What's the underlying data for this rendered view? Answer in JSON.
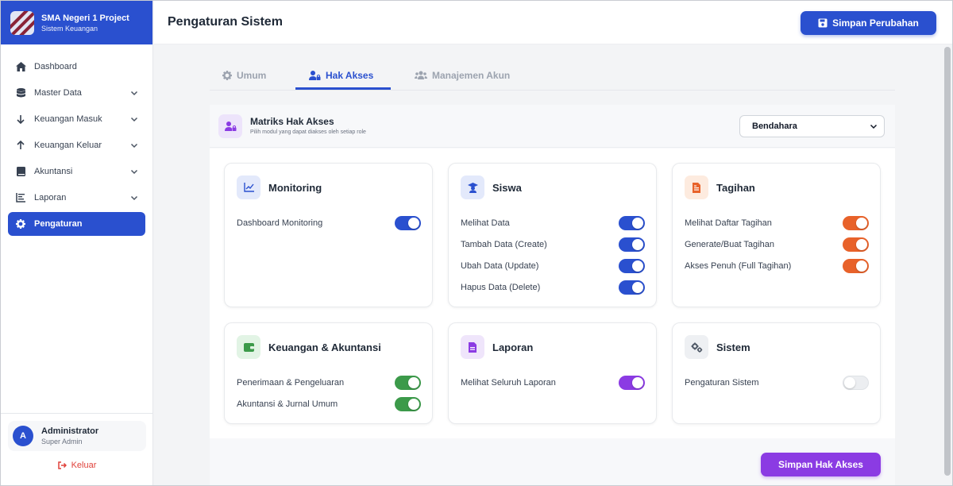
{
  "brand": {
    "name": "SMA Negeri 1 Project",
    "subtitle": "Sistem Keuangan"
  },
  "sidebar": {
    "items": [
      {
        "label": "Dashboard",
        "icon": "home-icon",
        "has_chevron": false,
        "active": false
      },
      {
        "label": "Master Data",
        "icon": "database-icon",
        "has_chevron": true,
        "active": false
      },
      {
        "label": "Keuangan Masuk",
        "icon": "arrow-down-icon",
        "has_chevron": true,
        "active": false
      },
      {
        "label": "Keuangan Keluar",
        "icon": "arrow-up-icon",
        "has_chevron": true,
        "active": false
      },
      {
        "label": "Akuntansi",
        "icon": "book-icon",
        "has_chevron": true,
        "active": false
      },
      {
        "label": "Laporan",
        "icon": "chart-bars-icon",
        "has_chevron": true,
        "active": false
      },
      {
        "label": "Pengaturan",
        "icon": "gear-icon",
        "has_chevron": false,
        "active": true
      }
    ],
    "user": {
      "avatar_letter": "A",
      "name": "Administrator",
      "role": "Super Admin"
    },
    "logout_label": "Keluar"
  },
  "header": {
    "title": "Pengaturan Sistem",
    "save_label": "Simpan Perubahan"
  },
  "tabs": [
    {
      "label": "Umum",
      "icon": "gear-icon",
      "active": false
    },
    {
      "label": "Hak Akses",
      "icon": "user-lock-icon",
      "active": true
    },
    {
      "label": "Manajemen Akun",
      "icon": "users-icon",
      "active": false
    }
  ],
  "panel": {
    "title": "Matriks Hak Akses",
    "subtitle": "Pilih modul yang dapat diakses oleh setiap role",
    "role_selected": "Bendahara",
    "save_access_label": "Simpan Hak Akses"
  },
  "modules": [
    {
      "title": "Monitoring",
      "icon": "chart-line-icon",
      "accent": "#2a50cf",
      "icon_bg": "#e3e9fb",
      "permissions": [
        {
          "label": "Dashboard Monitoring",
          "enabled": true
        }
      ]
    },
    {
      "title": "Siswa",
      "icon": "graduate-icon",
      "accent": "#2a50cf",
      "icon_bg": "#e3e9fb",
      "permissions": [
        {
          "label": "Melihat Data",
          "enabled": true
        },
        {
          "label": "Tambah Data (Create)",
          "enabled": true
        },
        {
          "label": "Ubah Data (Update)",
          "enabled": true
        },
        {
          "label": "Hapus Data (Delete)",
          "enabled": true
        }
      ]
    },
    {
      "title": "Tagihan",
      "icon": "invoice-icon",
      "accent": "#e8622a",
      "icon_bg": "#fdebdf",
      "permissions": [
        {
          "label": "Melihat Daftar Tagihan",
          "enabled": true
        },
        {
          "label": "Generate/Buat Tagihan",
          "enabled": true
        },
        {
          "label": "Akses Penuh (Full Tagihan)",
          "enabled": true
        }
      ]
    },
    {
      "title": "Keuangan & Akuntansi",
      "icon": "wallet-icon",
      "accent": "#3c9a4a",
      "icon_bg": "#e2f4e5",
      "permissions": [
        {
          "label": "Penerimaan & Pengeluaran",
          "enabled": true
        },
        {
          "label": "Akuntansi & Jurnal Umum",
          "enabled": true
        }
      ]
    },
    {
      "title": "Laporan",
      "icon": "file-icon",
      "accent": "#8b3be3",
      "icon_bg": "#efe5fb",
      "permissions": [
        {
          "label": "Melihat Seluruh Laporan",
          "enabled": true
        }
      ]
    },
    {
      "title": "Sistem",
      "icon": "gears-icon",
      "accent": "#4b5563",
      "icon_bg": "#eef0f3",
      "permissions": [
        {
          "label": "Pengaturan Sistem",
          "enabled": false
        }
      ]
    }
  ]
}
